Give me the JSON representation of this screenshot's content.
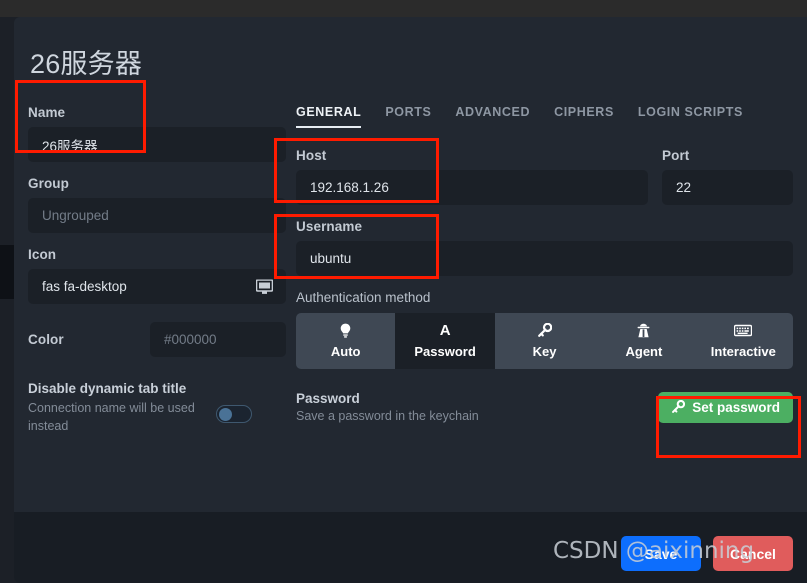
{
  "window": {
    "title": "26服务器"
  },
  "left": {
    "name": {
      "label": "Name",
      "value": "26服务器"
    },
    "group": {
      "label": "Group",
      "placeholder": "Ungrouped"
    },
    "icon": {
      "label": "Icon",
      "value": "fas fa-desktop",
      "glyph": "desktop-icon"
    },
    "color": {
      "label": "Color",
      "placeholder": "#000000"
    },
    "tab_title": {
      "title": "Disable dynamic tab title",
      "subtitle": "Connection name will be used instead",
      "enabled": false
    }
  },
  "tabs": [
    {
      "label": "GENERAL",
      "active": true
    },
    {
      "label": "PORTS",
      "active": false
    },
    {
      "label": "ADVANCED",
      "active": false
    },
    {
      "label": "CIPHERS",
      "active": false
    },
    {
      "label": "LOGIN SCRIPTS",
      "active": false
    }
  ],
  "right": {
    "host": {
      "label": "Host",
      "value": "192.168.1.26"
    },
    "port": {
      "label": "Port",
      "value": "22"
    },
    "username": {
      "label": "Username",
      "value": "ubuntu"
    },
    "auth": {
      "label": "Authentication method",
      "options": [
        {
          "label": "Auto",
          "icon": "lightbulb-icon",
          "selected": false
        },
        {
          "label": "Password",
          "icon": "letter-a-icon",
          "selected": true
        },
        {
          "label": "Key",
          "icon": "key-icon",
          "selected": false
        },
        {
          "label": "Agent",
          "icon": "user-secret-icon",
          "selected": false
        },
        {
          "label": "Interactive",
          "icon": "keyboard-icon",
          "selected": false
        }
      ]
    },
    "password": {
      "title": "Password",
      "subtitle": "Save a password in the keychain",
      "button": "Set password",
      "button_icon": "key-icon"
    }
  },
  "footer": {
    "save": "Save",
    "cancel": "Cancel"
  },
  "watermark": "CSDN @aixinning",
  "colors": {
    "accent_save": "#0d6efd",
    "accent_cancel": "#e05c5c",
    "accent_green": "#4caf62",
    "annotation": "#ff1b00"
  }
}
